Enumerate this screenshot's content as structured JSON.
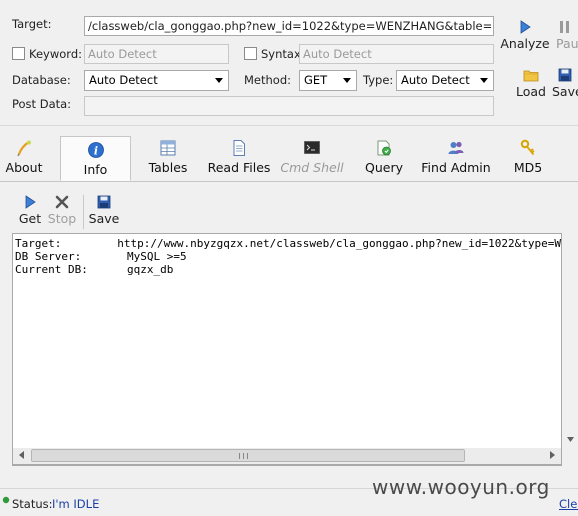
{
  "form": {
    "target_label": "Target:",
    "target_value": "/classweb/cla_gonggao.php?new_id=1022&type=WENZHANG&table=1",
    "keyword_label": "Keyword:",
    "keyword_placeholder": "Auto Detect",
    "syntax_label": "Syntax:",
    "syntax_placeholder": "Auto Detect",
    "database_label": "Database:",
    "database_value": "Auto Detect",
    "method_label": "Method:",
    "method_value": "GET",
    "type_label": "Type:",
    "type_value": "Auto Detect",
    "postdata_label": "Post Data:"
  },
  "side": {
    "analyze": "Analyze",
    "pause": "Pau",
    "load": "Load",
    "save": "Save"
  },
  "tabs": [
    {
      "label": "About"
    },
    {
      "label": "Info"
    },
    {
      "label": "Tables"
    },
    {
      "label": "Read Files"
    },
    {
      "label": "Cmd Shell"
    },
    {
      "label": "Query"
    },
    {
      "label": "Find Admin"
    },
    {
      "label": "MD5"
    }
  ],
  "toolbar": {
    "get": "Get",
    "stop": "Stop",
    "save": "Save"
  },
  "output": [
    {
      "key": "Target:",
      "value": "http://www.nbyzgqzx.net/classweb/cla_gonggao.php?new_id=1022&type=W"
    },
    {
      "key": "DB Server:",
      "value": "MySQL >=5"
    },
    {
      "key": "Current DB:",
      "value": "gqzx_db"
    }
  ],
  "status": {
    "label": "Status:",
    "value": "I'm IDLE",
    "clear": "Clea"
  },
  "watermark": "www.wooyun.org",
  "colors": {
    "accent": "#1f5fbf",
    "status_value": "#1a3fa6"
  }
}
